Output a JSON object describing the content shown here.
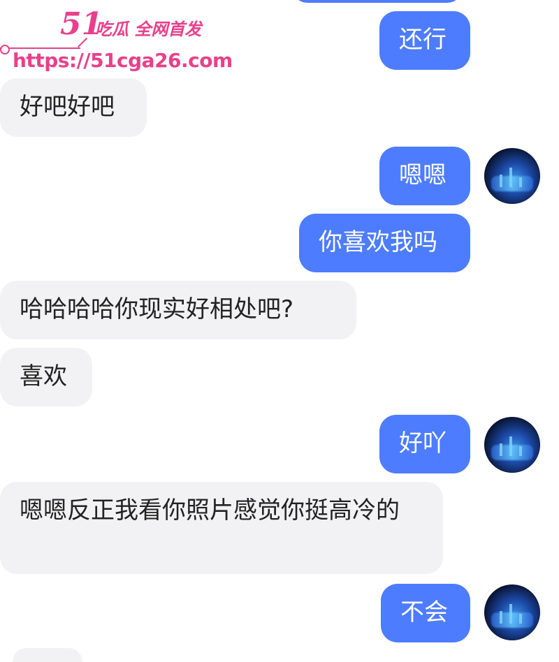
{
  "watermark": {
    "brand_number": "51",
    "brand_tagline": "吃瓜 全网首发",
    "url": "https://51cga26.com",
    "color": "#e8408b"
  },
  "colors": {
    "outgoing_bubble": "#4d7cfe",
    "incoming_bubble": "#f2f2f4",
    "background": "#ffffff"
  },
  "messages": [
    {
      "side": "out",
      "text": "还行"
    },
    {
      "side": "in",
      "text": "好吧好吧"
    },
    {
      "side": "out",
      "text": "嗯嗯"
    },
    {
      "side": "out",
      "text": "你喜欢我吗"
    },
    {
      "side": "in",
      "text": "哈哈哈哈你现实好相处吧?"
    },
    {
      "side": "in",
      "text": "喜欢"
    },
    {
      "side": "out",
      "text": "好吖"
    },
    {
      "side": "in",
      "text": "嗯嗯反正我看你照片感觉你挺高冷的"
    },
    {
      "side": "out",
      "text": "不会"
    }
  ]
}
